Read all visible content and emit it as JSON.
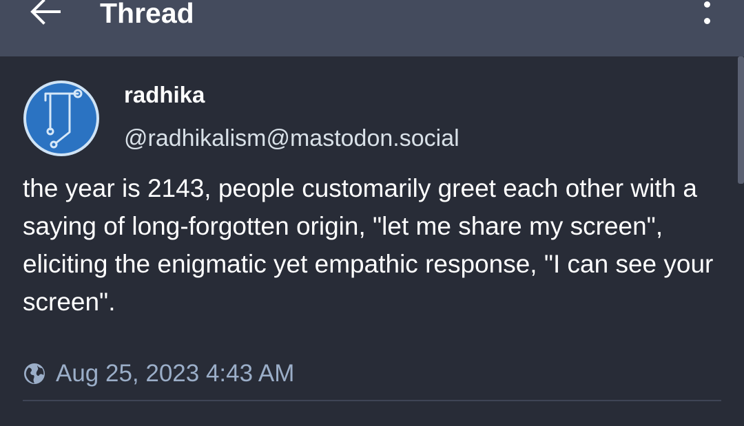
{
  "header": {
    "title": "Thread",
    "back_icon": "arrow-left-icon",
    "menu_icon": "more-vertical-icon"
  },
  "status": {
    "author": {
      "display_name": "radhika",
      "handle": "@radhikalism@mastodon.social",
      "avatar_icon": "avatar-logo-icon"
    },
    "content": "the year is 2143, people customarily greet each other with a saying of long-forgotten origin, \"let me share my screen\", eliciting the enigmatic yet empathic response, \"I can see your screen\".",
    "visibility_icon": "globe-icon",
    "timestamp": "Aug 25, 2023 4:43 AM"
  },
  "colors": {
    "header_bg": "#444b5d",
    "page_bg": "#282c37",
    "avatar_blue": "#2b73c2",
    "meta_text": "#9baec8"
  }
}
